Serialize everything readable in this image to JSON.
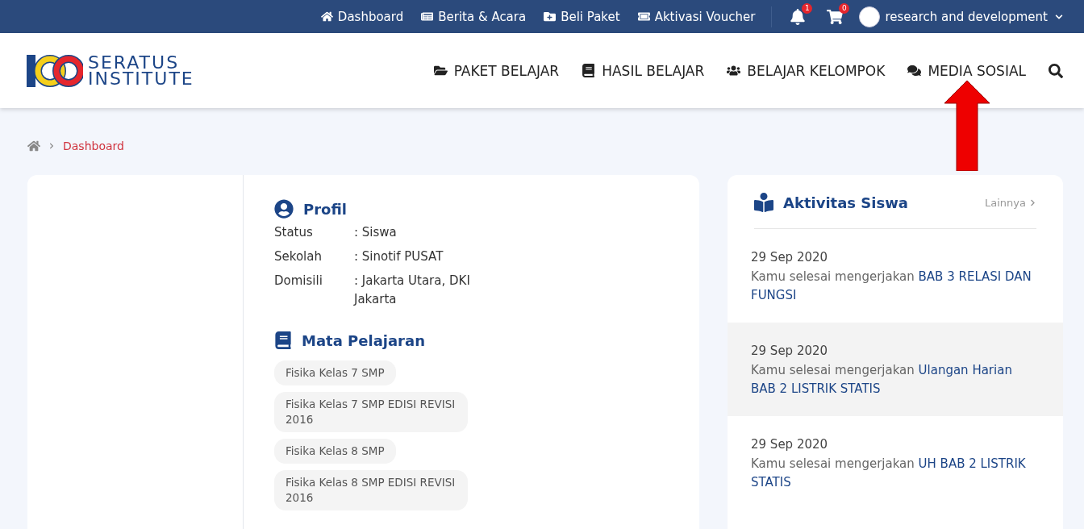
{
  "top_bar": {
    "links": [
      {
        "label": "Dashboard",
        "kind": "home"
      },
      {
        "label": "Berita & Acara",
        "kind": "news"
      },
      {
        "label": "Beli Paket",
        "kind": "buy"
      },
      {
        "label": "Aktivasi Voucher",
        "kind": "voucher"
      }
    ],
    "notifications": {
      "count": "1"
    },
    "cart": {
      "count": "0"
    },
    "user": {
      "name": "research and development"
    }
  },
  "header": {
    "logo": {
      "line_1": "SERATUS",
      "line_2": "INSTITUTE"
    },
    "menu": [
      {
        "label": "PAKET BELAJAR",
        "kind": "folder"
      },
      {
        "label": "HASIL BELAJAR",
        "kind": "book"
      },
      {
        "label": "BELAJAR KELOMPOK",
        "kind": "group"
      },
      {
        "label": "MEDIA SOSIAL",
        "kind": "chat",
        "annotated": true
      }
    ]
  },
  "breadcrumb": {
    "items": [
      "Dashboard"
    ]
  },
  "profile": {
    "title": "Profil",
    "fields": [
      {
        "label": "Status",
        "value": ": Siswa"
      },
      {
        "label": "Sekolah",
        "value": ": Sinotif PUSAT"
      },
      {
        "label": "Domisili",
        "value": ": Jakarta Utara, DKI Jakarta"
      }
    ]
  },
  "subjects": {
    "title": "Mata Pelajaran",
    "items": [
      "Fisika Kelas 7 SMP",
      "Fisika Kelas 7 SMP EDISI REVISI 2016",
      "Fisika Kelas 8 SMP",
      "Fisika Kelas 8 SMP EDISI REVISI 2016"
    ]
  },
  "activity": {
    "title": "Aktivitas Siswa",
    "more": "Lainnya",
    "items": [
      {
        "date": "29 Sep 2020",
        "action": "Kamu selesai mengerjakan",
        "subject": "BAB 3 RELASI DAN FUNGSI",
        "highlighted": false
      },
      {
        "date": "29 Sep 2020",
        "action": "Kamu selesai mengerjakan",
        "subject": "Ulangan Harian BAB 2 LISTRIK STATIS",
        "highlighted": true
      },
      {
        "date": "29 Sep 2020",
        "action": "Kamu selesai mengerjakan",
        "subject": "UH BAB 2 LISTRIK STATIS",
        "highlighted": false
      }
    ]
  }
}
